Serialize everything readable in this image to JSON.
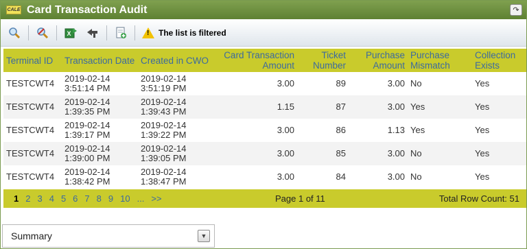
{
  "window": {
    "logo_text": "CALE",
    "title": "Card Transaction Audit"
  },
  "toolbar": {
    "buttons": [
      "search-icon",
      "clear-filter-icon",
      "export-excel-icon",
      "back-icon",
      "add-document-icon"
    ],
    "filter_message": "The list is filtered"
  },
  "table": {
    "columns": [
      {
        "label": "Terminal ID"
      },
      {
        "label": "Transaction Date"
      },
      {
        "label": "Created in CWO"
      },
      {
        "label": "Card Transaction Amount"
      },
      {
        "label": "Ticket Number"
      },
      {
        "label": "Purchase Amount"
      },
      {
        "label": "Purchase Mismatch"
      },
      {
        "label": "Collection Exists"
      }
    ],
    "rows": [
      {
        "terminal": "TESTCWT4",
        "tx_date": "2019-02-14",
        "tx_time": "3:51:14 PM",
        "cwo_date": "2019-02-14",
        "cwo_time": "3:51:19 PM",
        "card_amount": "3.00",
        "ticket": "89",
        "purchase_amount": "3.00",
        "mismatch": "No",
        "collection": "Yes"
      },
      {
        "terminal": "TESTCWT4",
        "tx_date": "2019-02-14",
        "tx_time": "1:39:35 PM",
        "cwo_date": "2019-02-14",
        "cwo_time": "1:39:43 PM",
        "card_amount": "1.15",
        "ticket": "87",
        "purchase_amount": "3.00",
        "mismatch": "Yes",
        "collection": "Yes"
      },
      {
        "terminal": "TESTCWT4",
        "tx_date": "2019-02-14",
        "tx_time": "1:39:17 PM",
        "cwo_date": "2019-02-14",
        "cwo_time": "1:39:22 PM",
        "card_amount": "3.00",
        "ticket": "86",
        "purchase_amount": "1.13",
        "mismatch": "Yes",
        "collection": "Yes"
      },
      {
        "terminal": "TESTCWT4",
        "tx_date": "2019-02-14",
        "tx_time": "1:39:00 PM",
        "cwo_date": "2019-02-14",
        "cwo_time": "1:39:05 PM",
        "card_amount": "3.00",
        "ticket": "85",
        "purchase_amount": "3.00",
        "mismatch": "No",
        "collection": "Yes"
      },
      {
        "terminal": "TESTCWT4",
        "tx_date": "2019-02-14",
        "tx_time": "1:38:42 PM",
        "cwo_date": "2019-02-14",
        "cwo_time": "1:38:47 PM",
        "card_amount": "3.00",
        "ticket": "84",
        "purchase_amount": "3.00",
        "mismatch": "No",
        "collection": "Yes"
      }
    ]
  },
  "pager": {
    "pages": [
      "1",
      "2",
      "3",
      "4",
      "5",
      "6",
      "7",
      "8",
      "9",
      "10",
      "...",
      ">>"
    ],
    "current": "1",
    "page_info": "Page 1 of 11",
    "row_count": "Total Row Count: 51"
  },
  "summary": {
    "label": "Summary"
  },
  "colors": {
    "title_bar": "#6a8c3c",
    "header_band": "#c9cb2c",
    "header_text": "#3b6aa0"
  }
}
